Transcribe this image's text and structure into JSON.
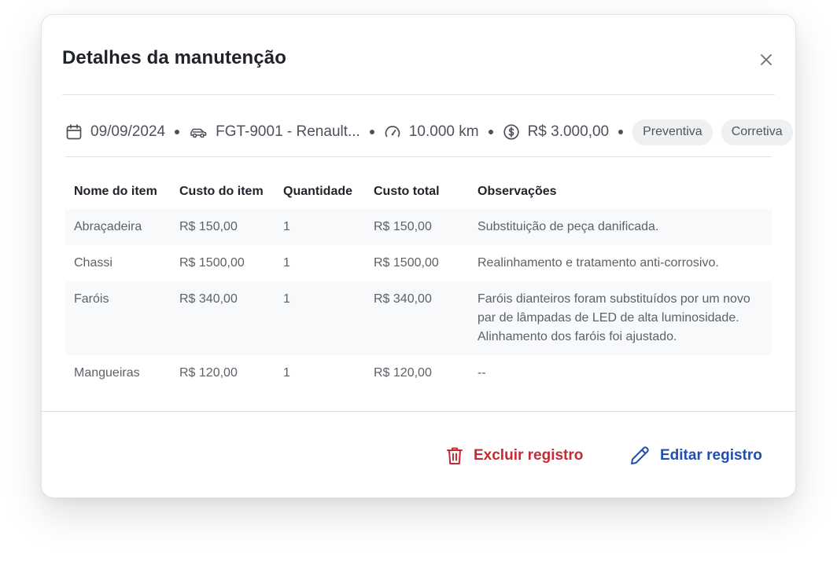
{
  "modal": {
    "title": "Detalhes da manutenção",
    "close_icon": "close-icon"
  },
  "meta": {
    "date": "09/09/2024",
    "vehicle": "FGT-9001 - Renault...",
    "mileage": "10.000 km",
    "cost": "R$ 3.000,00",
    "tags": [
      "Preventiva",
      "Corretiva"
    ],
    "icons": {
      "date": "calendar-icon",
      "vehicle": "car-icon",
      "mileage": "speedometer-icon",
      "cost": "dollar-coin-icon"
    }
  },
  "table": {
    "headers": [
      "Nome do item",
      "Custo do item",
      "Quantidade",
      "Custo total",
      "Observações"
    ],
    "rows": [
      [
        "Abraçadeira",
        "R$ 150,00",
        "1",
        "R$ 150,00",
        "Substituição de peça danificada."
      ],
      [
        "Chassi",
        "R$ 1500,00",
        "1",
        "R$ 1500,00",
        "Realinhamento e tratamento anti-corrosivo."
      ],
      [
        "Faróis",
        "R$ 340,00",
        "1",
        "R$ 340,00",
        "Faróis dianteiros foram substituídos por um novo par de lâmpadas de LED de alta luminosidade. Alinhamento dos faróis foi ajustado."
      ],
      [
        "Mangueiras",
        "R$ 120,00",
        "1",
        "R$ 120,00",
        "--"
      ]
    ]
  },
  "footer": {
    "delete_label": "Excluir registro",
    "edit_label": "Editar registro"
  },
  "colors": {
    "danger": "#c62a35",
    "primary": "#1e4fb4",
    "row_shade": "#f7f9fb",
    "chip_bg": "#eff0f1"
  }
}
